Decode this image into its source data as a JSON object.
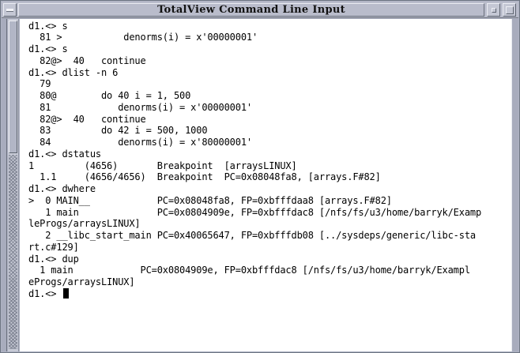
{
  "window": {
    "title": "TotalView Command Line Input"
  },
  "terminal": {
    "lines": [
      "d1.<> s",
      "  81 >           denorms(i) = x'00000001'",
      "d1.<> s",
      "  82@>  40   continue",
      "d1.<> dlist -n 6",
      "  79",
      "  80@        do 40 i = 1, 500",
      "  81            denorms(i) = x'00000001'",
      "  82@>  40   continue",
      "  83         do 42 i = 500, 1000",
      "  84            denorms(i) = x'80000001'",
      "d1.<> dstatus",
      "1         (4656)       Breakpoint  [arraysLINUX]",
      "  1.1     (4656/4656)  Breakpoint  PC=0x08048fa8, [arrays.F#82]",
      "d1.<> dwhere",
      ">  0 MAIN__            PC=0x08048fa8, FP=0xbfffdaa8 [arrays.F#82]",
      "   1 main              PC=0x0804909e, FP=0xbfffdac8 [/nfs/fs/u3/home/barryk/Examp",
      "leProgs/arraysLINUX]",
      "   2 __libc_start_main PC=0x40065647, FP=0xbfffdb08 [../sysdeps/generic/libc-sta",
      "rt.c#129]",
      "d1.<> dup",
      "  1 main            PC=0x0804909e, FP=0xbfffdac8 [/nfs/fs/u3/home/barryk/Exampl",
      "eProgs/arraysLINUX]",
      "d1.<> "
    ]
  }
}
